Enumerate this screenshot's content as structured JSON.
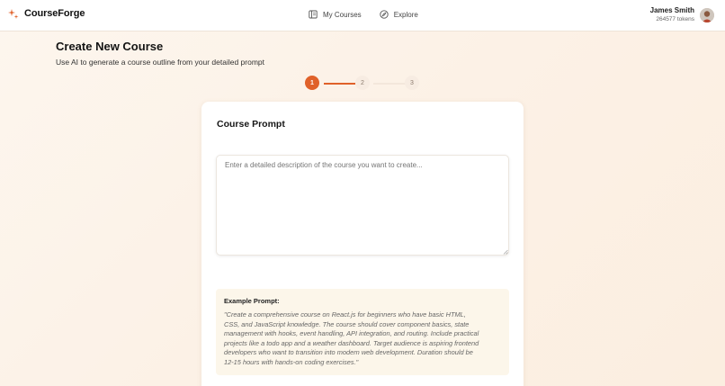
{
  "brand": {
    "name": "CourseForge",
    "accent": "#e0612a"
  },
  "nav": [
    {
      "label": "My Courses",
      "icon": "book-icon"
    },
    {
      "label": "Explore",
      "icon": "compass-icon"
    }
  ],
  "user": {
    "name": "James Smith",
    "tokens": "264577 tokens"
  },
  "page": {
    "title": "Create New Course",
    "subtitle": "Use AI to generate a course outline from your detailed prompt"
  },
  "stepper": {
    "steps": [
      "1",
      "2",
      "3"
    ],
    "current_step": 1
  },
  "card": {
    "title": "Course Prompt",
    "prompt_placeholder": "Enter a detailed description of the course you want to create...",
    "prompt_value": "",
    "example_label": "Example Prompt:",
    "example_lines": [
      "\"Create a comprehensive course on React.js for beginners who have basic HTML,",
      "CSS, and JavaScript knowledge. The course should cover component basics, state",
      "management with hooks, event handling, API integration, and routing. Include practical",
      "projects like a todo app and a weather dashboard. Target audience is aspiring frontend",
      "developers who want to transition into modern web development. Duration should be",
      "12-15 hours with hands-on coding exercises.\""
    ]
  }
}
